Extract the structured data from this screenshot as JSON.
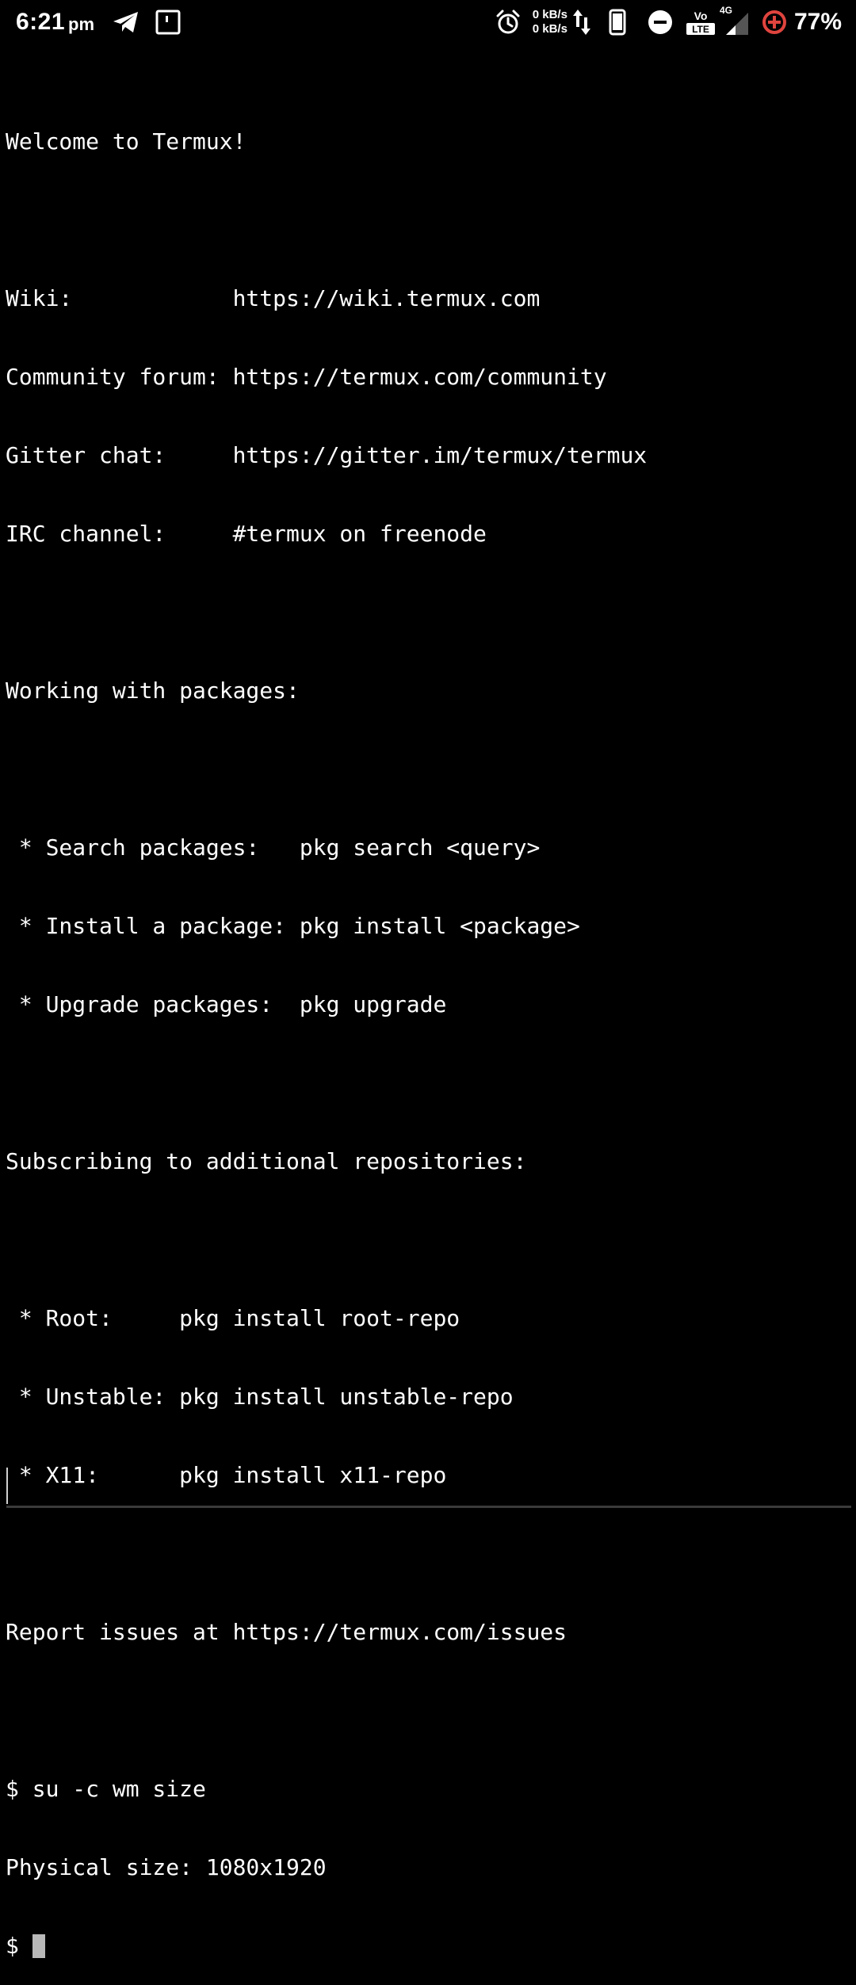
{
  "status_bar": {
    "time": "6:21",
    "ampm": "pm",
    "net_speed_up": "0 kB/s",
    "net_speed_down": "0 kB/s",
    "network_type": "4G",
    "volte_top": "Vo",
    "volte_bottom": "LTE",
    "battery_percent": "77%",
    "icons": [
      "telegram-icon",
      "screen-icon",
      "alarm-icon",
      "data-arrows-icon",
      "phone-icon",
      "dnd-icon",
      "volte-icon",
      "signal-icon",
      "battery-saver-icon"
    ]
  },
  "terminal": {
    "lines": [
      "Welcome to Termux!",
      "",
      "Wiki:            https://wiki.termux.com",
      "Community forum: https://termux.com/community",
      "Gitter chat:     https://gitter.im/termux/termux",
      "IRC channel:     #termux on freenode",
      "",
      "Working with packages:",
      "",
      " * Search packages:   pkg search <query>",
      " * Install a package: pkg install <package>",
      " * Upgrade packages:  pkg upgrade",
      "",
      "Subscribing to additional repositories:",
      "",
      " * Root:     pkg install root-repo",
      " * Unstable: pkg install unstable-repo",
      " * X11:      pkg install x11-repo",
      "",
      "Report issues at https://termux.com/issues",
      "",
      "$ su -c wm size",
      "Physical size: 1080x1920"
    ],
    "prompt": "$ "
  },
  "colors": {
    "background": "#000000",
    "text": "#ffffff",
    "cursor": "#b8b8b8",
    "battery_saver": "#e0443e"
  }
}
